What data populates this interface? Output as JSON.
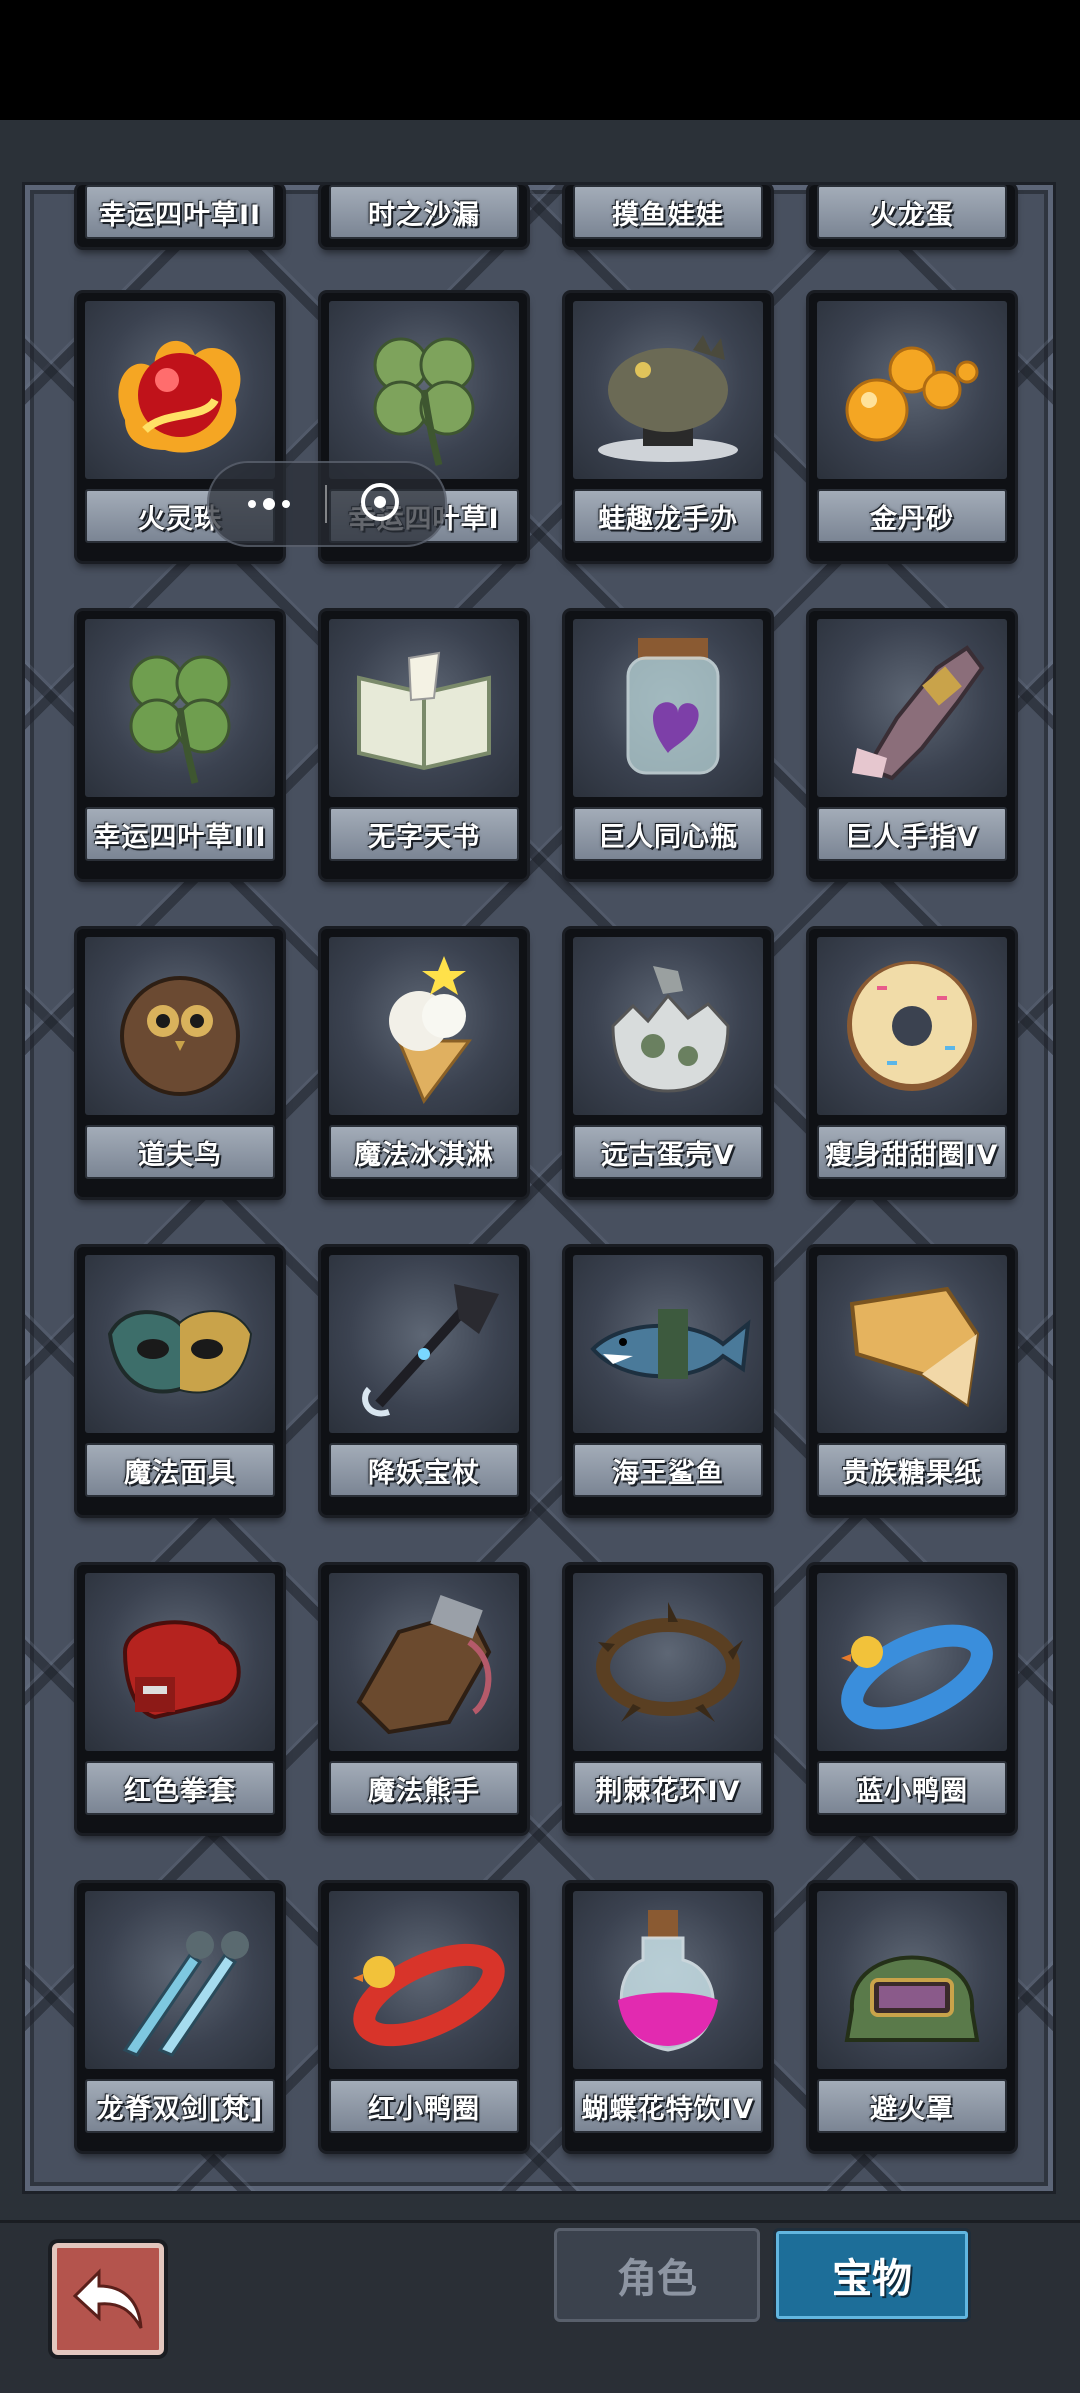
{
  "partial_row": [
    "幸运四叶草II",
    "时之沙漏",
    "摸鱼娃娃",
    "火龙蛋"
  ],
  "grid": [
    [
      {
        "name": "火灵珠",
        "icon": "fire-orb-icon"
      },
      {
        "name": "幸运四叶草I",
        "icon": "four-leaf-clover-icon"
      },
      {
        "name": "蛙趣龙手办",
        "icon": "toad-dragon-figure-icon"
      },
      {
        "name": "金丹砂",
        "icon": "golden-pills-icon"
      }
    ],
    [
      {
        "name": "幸运四叶草III",
        "icon": "four-leaf-clover-icon"
      },
      {
        "name": "无字天书",
        "icon": "open-book-icon"
      },
      {
        "name": "巨人同心瓶",
        "icon": "heart-jar-icon"
      },
      {
        "name": "巨人手指V",
        "icon": "giant-finger-icon"
      }
    ],
    [
      {
        "name": "道夫鸟",
        "icon": "owl-icon"
      },
      {
        "name": "魔法冰淇淋",
        "icon": "ice-cream-icon"
      },
      {
        "name": "远古蛋壳V",
        "icon": "broken-eggshell-icon"
      },
      {
        "name": "瘦身甜甜圈IV",
        "icon": "donut-icon"
      }
    ],
    [
      {
        "name": "魔法面具",
        "icon": "mask-icon"
      },
      {
        "name": "降妖宝杖",
        "icon": "magic-staff-icon"
      },
      {
        "name": "海王鲨鱼",
        "icon": "shark-icon"
      },
      {
        "name": "贵族糖果纸",
        "icon": "candy-wrapper-icon"
      }
    ],
    [
      {
        "name": "红色拳套",
        "icon": "boxing-glove-icon"
      },
      {
        "name": "魔法熊手",
        "icon": "bear-paw-icon"
      },
      {
        "name": "荆棘花环IV",
        "icon": "thorn-wreath-icon"
      },
      {
        "name": "蓝小鸭圈",
        "icon": "blue-duck-ring-icon"
      }
    ],
    [
      {
        "name": "龙脊双剑[梵]",
        "icon": "twin-swords-icon"
      },
      {
        "name": "红小鸭圈",
        "icon": "red-duck-ring-icon"
      },
      {
        "name": "蝴蝶花特饮IV",
        "icon": "potion-bottle-icon"
      },
      {
        "name": "避火罩",
        "icon": "fire-helmet-icon"
      }
    ]
  ],
  "tabs": {
    "role": "角色",
    "treasure": "宝物"
  },
  "colors": {
    "accent_tab": "#1d6e99",
    "back_button": "#b4544d",
    "panel": "#48505f"
  }
}
